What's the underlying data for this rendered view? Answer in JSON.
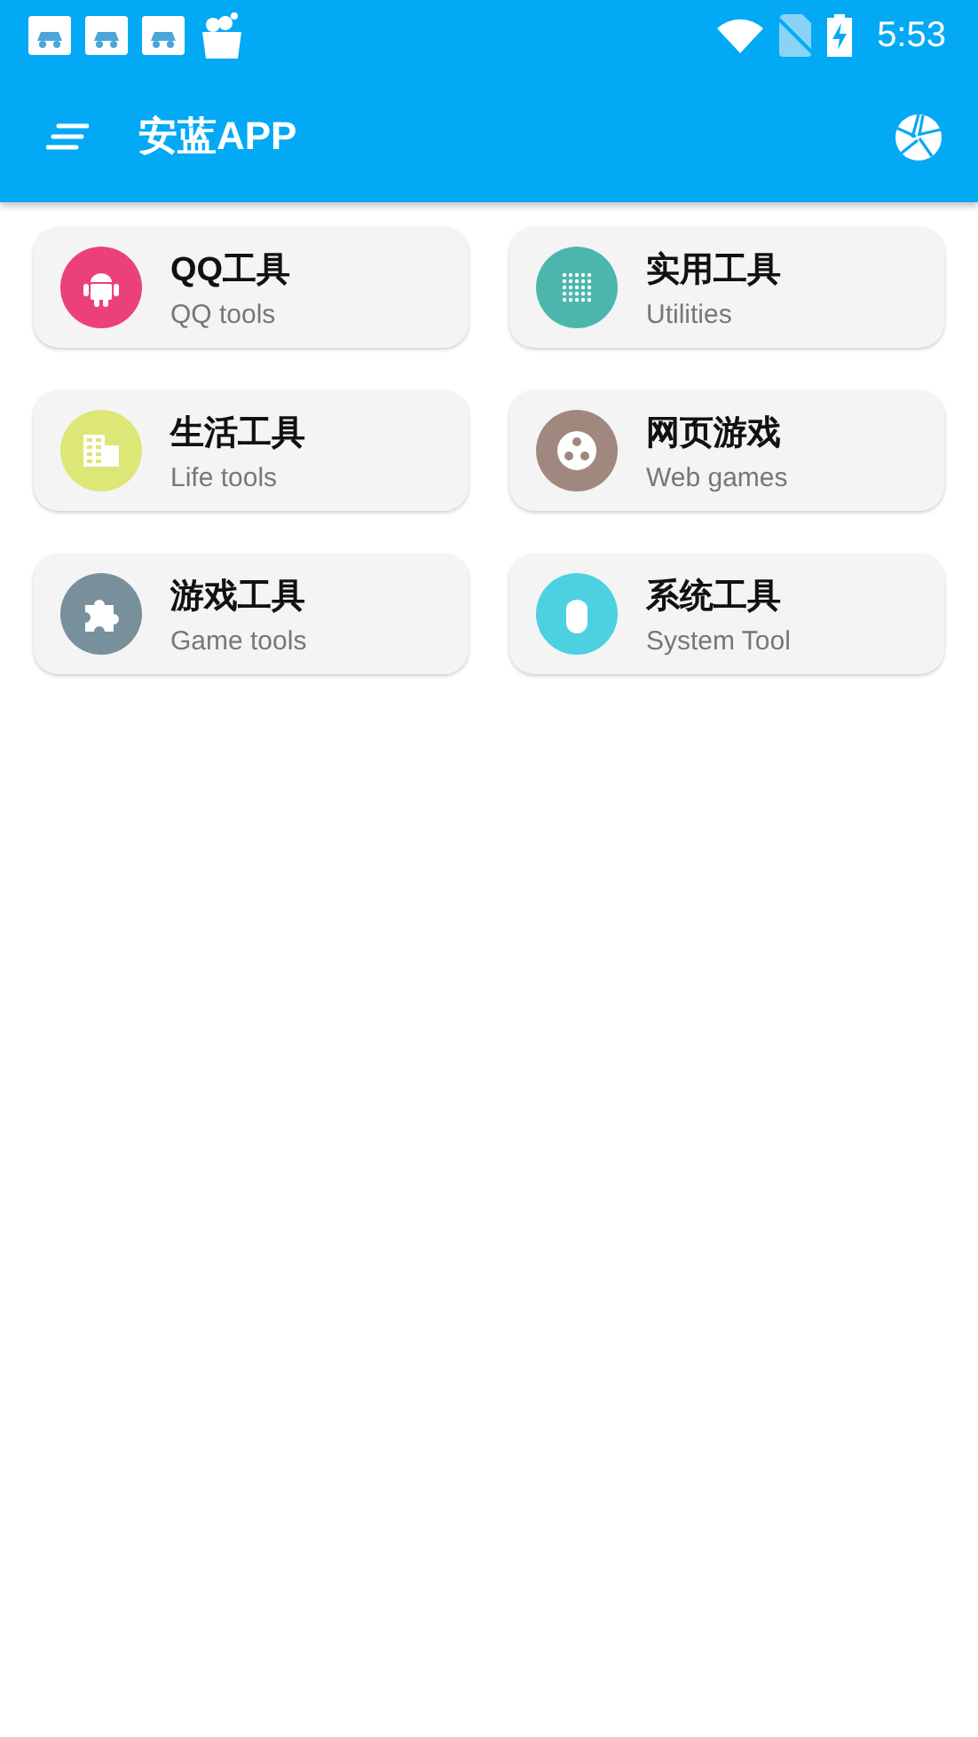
{
  "status_bar": {
    "time": "5:53"
  },
  "app_bar": {
    "title": "安蓝APP"
  },
  "categories": [
    {
      "title": "QQ工具",
      "subtitle": "QQ tools",
      "color": "#ec407a"
    },
    {
      "title": "实用工具",
      "subtitle": "Utilities",
      "color": "#4db6ac"
    },
    {
      "title": "生活工具",
      "subtitle": "Life tools",
      "color": "#dce775"
    },
    {
      "title": "网页游戏",
      "subtitle": "Web games",
      "color": "#a1887f"
    },
    {
      "title": "游戏工具",
      "subtitle": "Game tools",
      "color": "#78909c"
    },
    {
      "title": "系统工具",
      "subtitle": "System Tool",
      "color": "#4dd0e1"
    }
  ]
}
